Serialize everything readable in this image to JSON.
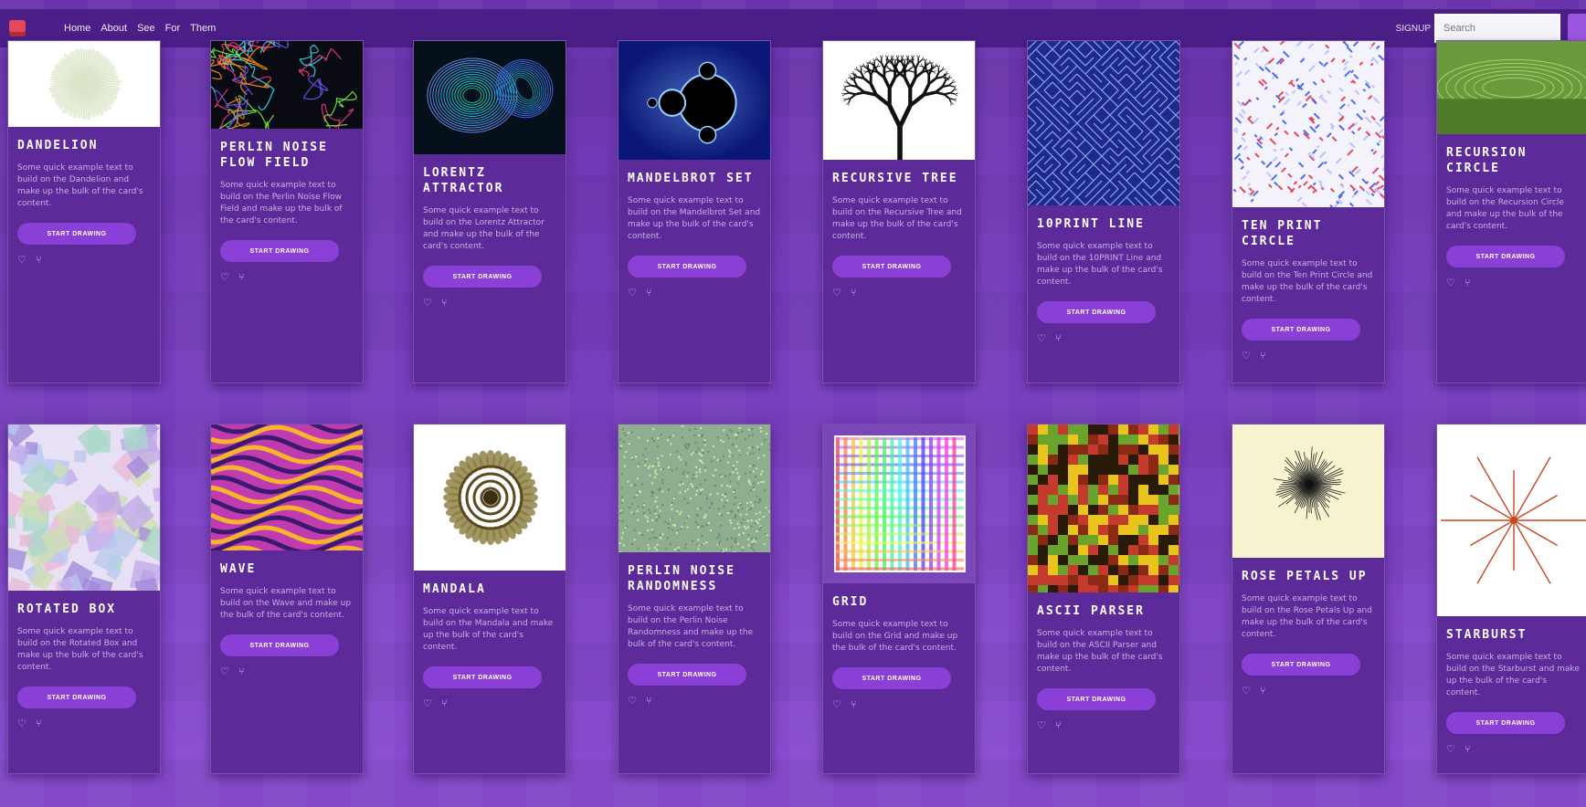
{
  "nav": {
    "links": [
      "Home",
      "About",
      "See",
      "For",
      "Them"
    ],
    "user_label": "SIGNUP",
    "search_placeholder": "Search"
  },
  "cards": [
    {
      "title": "DANDELION",
      "description": "Some quick example text to build on the Dandelion and make up the bulk of the card's content.",
      "button": "START DRAWING",
      "thumb": "dandelion"
    },
    {
      "title": "PERLIN NOISE FLOW FIELD",
      "description": "Some quick example text to build on the Perlin Noise Flow Field and make up the bulk of the card's content.",
      "button": "START DRAWING",
      "thumb": "flowfield"
    },
    {
      "title": "LORENTZ ATTRACTOR",
      "description": "Some quick example text to build on the Lorentz Attractor and make up the bulk of the card's content.",
      "button": "START DRAWING",
      "thumb": "lorenz"
    },
    {
      "title": "MANDELBROT SET",
      "description": "Some quick example text to build on the Mandelbrot Set and make up the bulk of the card's content.",
      "button": "START DRAWING",
      "thumb": "mandelbrot"
    },
    {
      "title": "RECURSIVE TREE",
      "description": "Some quick example text to build on the Recursive Tree and make up the bulk of the card's content.",
      "button": "START DRAWING",
      "thumb": "tree"
    },
    {
      "title": "10PRINT LINE",
      "description": "Some quick example text to build on the 10PRINT Line and make up the bulk of the card's content.",
      "button": "START DRAWING",
      "thumb": "tenprint"
    },
    {
      "title": "TEN PRINT CIRCLE",
      "description": "Some quick example text to build on the Ten Print Circle and make up the bulk of the card's content.",
      "button": "START DRAWING",
      "thumb": "tenprintcircle"
    },
    {
      "title": "RECURSION CIRCLE",
      "description": "Some quick example text to build on the Recursion Circle and make up the bulk of the card's content.",
      "button": "START DRAWING",
      "thumb": "recursion"
    },
    {
      "title": "ROTATED BOX",
      "description": "Some quick example text to build on the Rotated Box and make up the bulk of the card's content.",
      "button": "START DRAWING",
      "thumb": "rotatedbox"
    },
    {
      "title": "WAVE",
      "description": "Some quick example text to build on the Wave and make up the bulk of the card's content.",
      "button": "START DRAWING",
      "thumb": "wave"
    },
    {
      "title": "MANDALA",
      "description": "Some quick example text to build on the Mandala and make up the bulk of the card's content.",
      "button": "START DRAWING",
      "thumb": "mandala"
    },
    {
      "title": "PERLIN NOISE RANDOMNESS",
      "description": "Some quick example text to build on the Perlin Noise Randomness and make up the bulk of the card's content.",
      "button": "START DRAWING",
      "thumb": "perlinrand"
    },
    {
      "title": "GRID",
      "description": "Some quick example text to build on the Grid and make up the bulk of the card's content.",
      "button": "START DRAWING",
      "thumb": "grid"
    },
    {
      "title": "ASCII PARSER",
      "description": "Some quick example text to build on the ASCII Parser and make up the bulk of the card's content.",
      "button": "START DRAWING",
      "thumb": "ascii"
    },
    {
      "title": "ROSE PETALS UP",
      "description": "Some quick example text to build on the Rose Petals Up and make up the bulk of the card's content.",
      "button": "START DRAWING",
      "thumb": "rose"
    },
    {
      "title": "STARBURST",
      "description": "Some quick example text to build on the Starburst and make up the bulk of the card's content.",
      "button": "START DRAWING",
      "thumb": "starburst"
    }
  ]
}
